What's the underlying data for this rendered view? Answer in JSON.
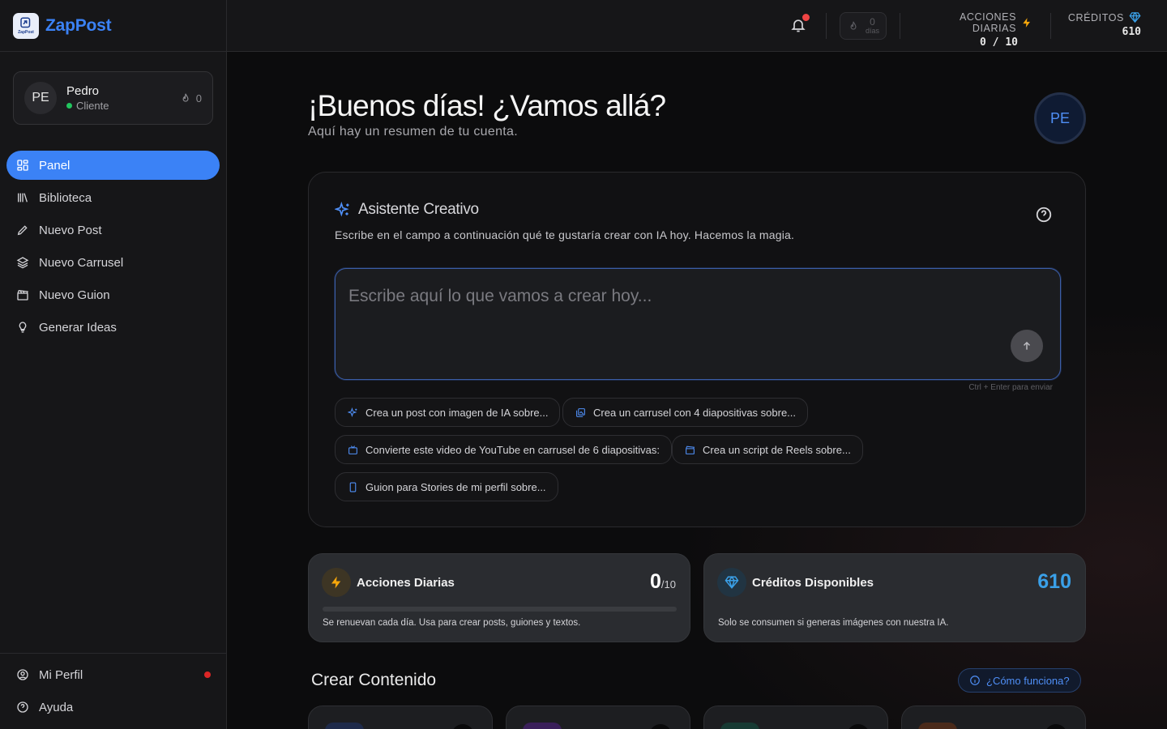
{
  "app": {
    "name": "ZapPost",
    "logo_small": "ZapPost"
  },
  "user": {
    "initials": "PE",
    "name": "Pedro",
    "role": "Cliente",
    "streak": "0"
  },
  "nav": [
    {
      "label": "Panel",
      "icon": "grid-icon",
      "active": true
    },
    {
      "label": "Biblioteca",
      "icon": "library-icon"
    },
    {
      "label": "Nuevo Post",
      "icon": "pencil-icon"
    },
    {
      "label": "Nuevo Carrusel",
      "icon": "layers-icon"
    },
    {
      "label": "Nuevo Guion",
      "icon": "clapperboard-icon"
    },
    {
      "label": "Generar Ideas",
      "icon": "lightbulb-icon"
    }
  ],
  "nav_bottom": [
    {
      "label": "Mi Perfil",
      "icon": "user-circle-icon"
    },
    {
      "label": "Ayuda",
      "icon": "help-circle-icon"
    }
  ],
  "topbar": {
    "streak_num": "0",
    "streak_label": "días",
    "daily_label": "ACCIONES DIARIAS",
    "daily_value": "0 / 10",
    "credits_label": "CRÉDITOS",
    "credits_value": "610"
  },
  "greeting": {
    "title": "¡Buenos días! ¿Vamos allá?",
    "subtitle": "Aquí hay un resumen de tu cuenta."
  },
  "assistant": {
    "title": "Asistente Creativo",
    "subtitle": "Escribe en el campo a continuación qué te gustaría crear con IA hoy. Hacemos la magia.",
    "placeholder": "Escribe aquí lo que vamos a crear hoy...",
    "hint": "Ctrl + Enter para enviar",
    "chips": [
      "Crea un post con imagen de IA sobre...",
      "Crea un carrusel con 4 diapositivas sobre...",
      "Convierte este video de YouTube en carrusel de 6 diapositivas:",
      "Crea un script de Reels sobre...",
      "Guion para Stories de mi perfil sobre..."
    ]
  },
  "stats": {
    "daily": {
      "title": "Acciones Diarias",
      "value": "0",
      "max": "/10",
      "progress": 0,
      "desc": "Se renuevan cada día. Usa para crear posts, guiones y textos."
    },
    "credits": {
      "title": "Créditos Disponibles",
      "value": "610",
      "desc": "Solo se consumen si generas imágenes con nuestra IA."
    }
  },
  "create": {
    "title": "Crear Contenido",
    "how_label": "¿Cómo funciona?"
  },
  "colors": {
    "accent": "#3b82f6",
    "warning": "#f59e0b",
    "credits": "#3aa0e8",
    "danger": "#ef4444",
    "success": "#22c55e"
  }
}
